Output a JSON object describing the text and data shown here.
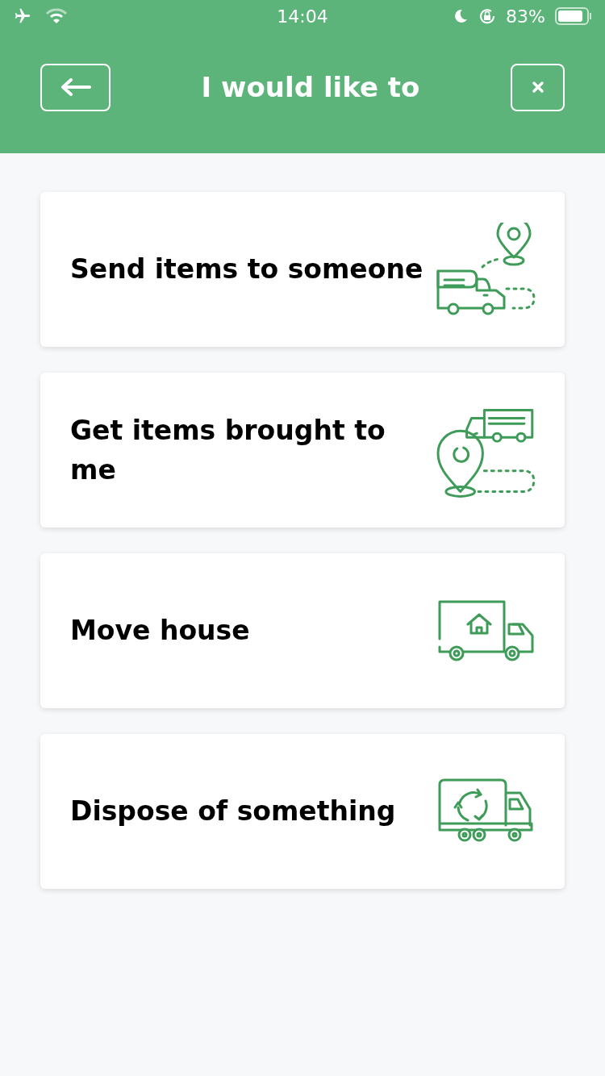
{
  "status_bar": {
    "time": "14:04",
    "battery": "83%"
  },
  "header": {
    "title": "I would like to"
  },
  "options": [
    {
      "label": "Send items to someone",
      "kind": "send"
    },
    {
      "label": "Get items brought to me",
      "kind": "receive"
    },
    {
      "label": "Move house",
      "kind": "move"
    },
    {
      "label": "Dispose of something",
      "kind": "dispose"
    }
  ]
}
